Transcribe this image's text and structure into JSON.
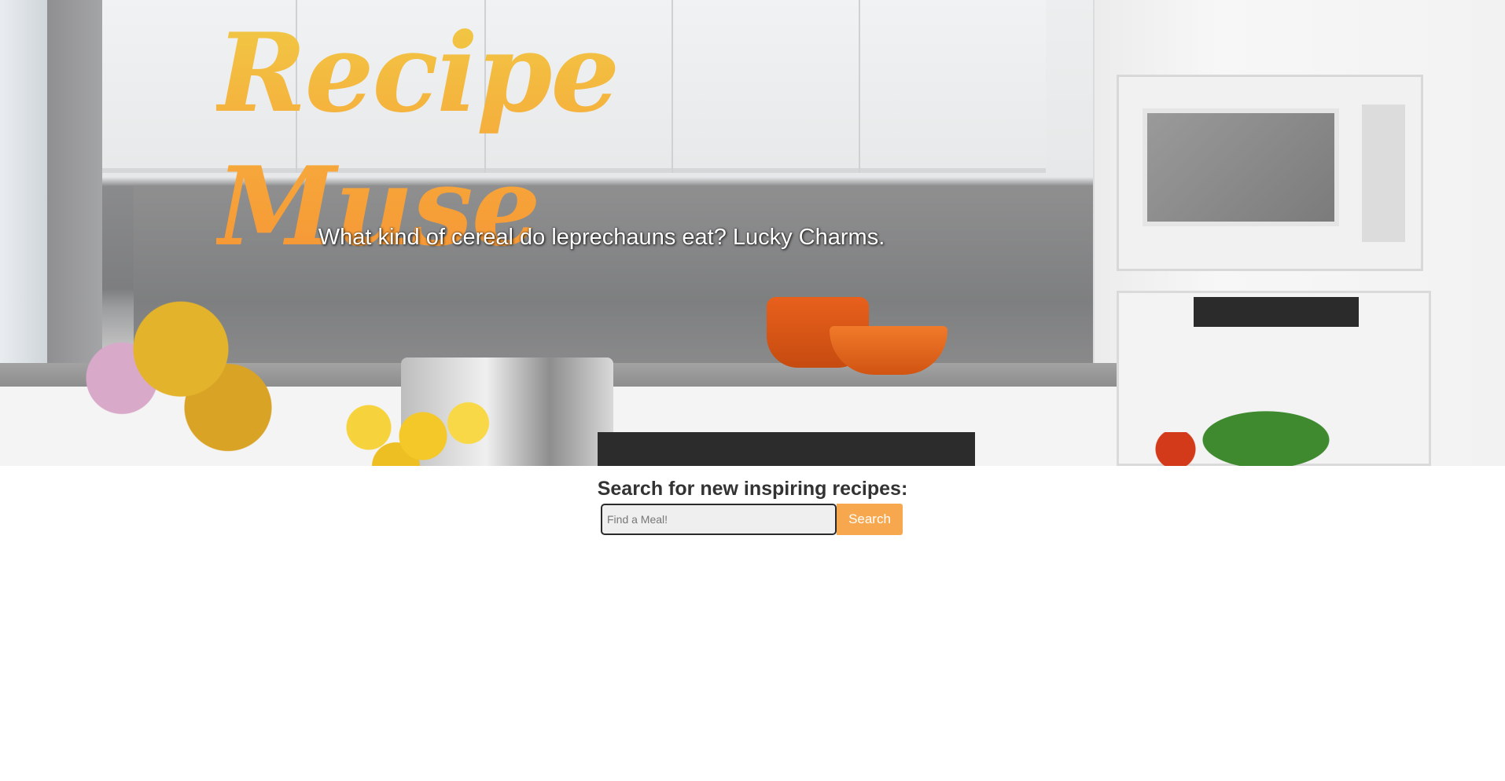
{
  "hero": {
    "title": "Recipe Muse",
    "joke": "What kind of cereal do leprechauns eat? Lucky Charms."
  },
  "search": {
    "heading": "Search for new inspiring recipes:",
    "placeholder": "Find a Meal!",
    "value": "",
    "button_label": "Search"
  },
  "colors": {
    "title_gradient": [
      "#f1ca45",
      "#f59436"
    ],
    "button_bg": "#f7a84f",
    "heading_text": "#333333"
  }
}
